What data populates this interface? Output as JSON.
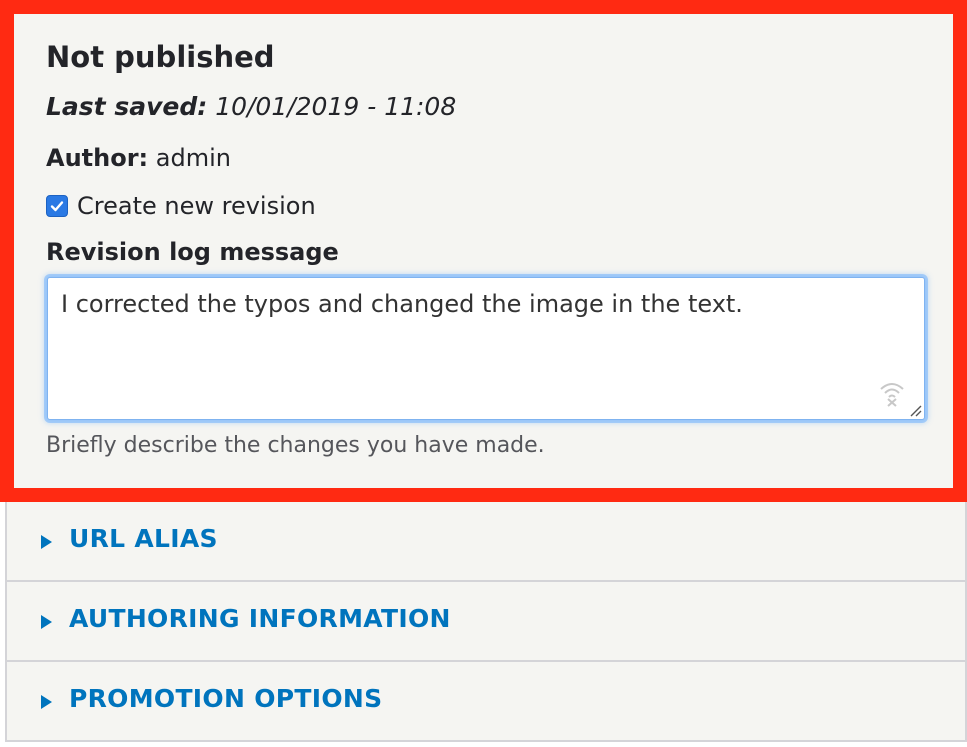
{
  "meta": {
    "status_title": "Not published",
    "last_saved_label": "Last saved:",
    "last_saved_value": "10/01/2019 - 11:08",
    "author_label": "Author:",
    "author_value": "admin"
  },
  "revision": {
    "checkbox_label": "Create new revision",
    "checked": true,
    "log_label": "Revision log message",
    "log_value": "I corrected the typos and changed the image in the text.",
    "help_text": "Briefly describe the changes you have made."
  },
  "accordion": {
    "items": [
      {
        "label": "URL ALIAS",
        "icon": "triangle-right-icon"
      },
      {
        "label": "AUTHORING INFORMATION",
        "icon": "triangle-right-icon"
      },
      {
        "label": "PROMOTION OPTIONS",
        "icon": "triangle-right-icon"
      }
    ]
  },
  "colors": {
    "highlight_border": "#ff2a12",
    "link": "#0074bd",
    "checkbox": "#2a79e4",
    "panel_bg": "#f5f5f2"
  }
}
